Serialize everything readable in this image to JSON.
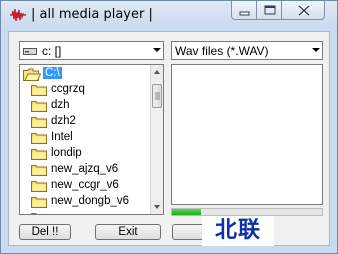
{
  "window": {
    "title": "| all media player |"
  },
  "drive_combo": {
    "value": "c: []"
  },
  "filter_combo": {
    "value": "Wav files (*.WAV)"
  },
  "dir_list": {
    "items": [
      {
        "label": "C:\\",
        "selected": true
      },
      {
        "label": "ccgrzq"
      },
      {
        "label": "dzh"
      },
      {
        "label": "dzh2"
      },
      {
        "label": "Intel"
      },
      {
        "label": "londip"
      },
      {
        "label": "new_ajzq_v6"
      },
      {
        "label": "new_ccgr_v6"
      },
      {
        "label": "new_dongb_v6"
      },
      {
        "label": ""
      }
    ]
  },
  "progress": {
    "fraction": 0.19
  },
  "buttons": {
    "del_label": "Del !!",
    "exit_label": "Exit",
    "third_label": ""
  },
  "watermark": {
    "text": "北联"
  },
  "colors": {
    "accent_selection": "#3399ff",
    "progress_green": "#14b014",
    "watermark_blue": "#0b2fa8"
  }
}
